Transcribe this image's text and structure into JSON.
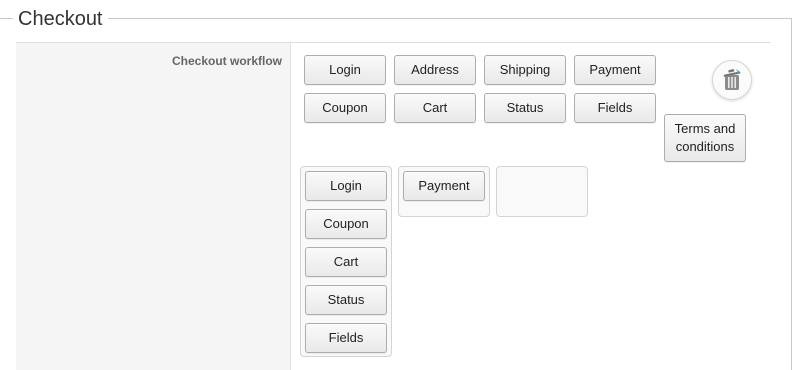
{
  "fieldset": {
    "legend": "Checkout"
  },
  "field": {
    "label": "Checkout workflow"
  },
  "palette": {
    "items": [
      "Login",
      "Address",
      "Shipping",
      "Payment",
      "Coupon",
      "Cart",
      "Status",
      "Fields",
      "Terms and conditions"
    ]
  },
  "trash": {
    "icon": "trash-icon"
  },
  "steps": [
    {
      "items": [
        "Login",
        "Coupon",
        "Cart",
        "Status",
        "Fields"
      ]
    },
    {
      "items": [
        "Payment"
      ]
    },
    {
      "items": []
    }
  ]
}
